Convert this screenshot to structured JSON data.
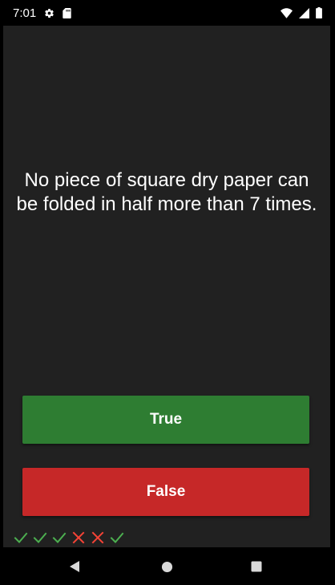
{
  "status_bar": {
    "time": "7:01",
    "left_icons": [
      "gear-icon",
      "sd-card-icon"
    ],
    "right_icons": [
      "wifi-icon",
      "cellular-signal-icon",
      "battery-icon"
    ]
  },
  "quiz": {
    "question": "No piece of square dry paper can be folded in half more than 7 times.",
    "true_label": "True",
    "false_label": "False"
  },
  "score_history": [
    "correct",
    "correct",
    "correct",
    "incorrect",
    "incorrect",
    "correct"
  ],
  "nav_bar": {
    "icons": [
      "back-icon",
      "home-icon",
      "recents-icon"
    ]
  },
  "colors": {
    "background": "#212121",
    "true_button": "#2e7d32",
    "false_button": "#c62828",
    "correct_mark": "#4caf50",
    "incorrect_mark": "#f44336"
  }
}
